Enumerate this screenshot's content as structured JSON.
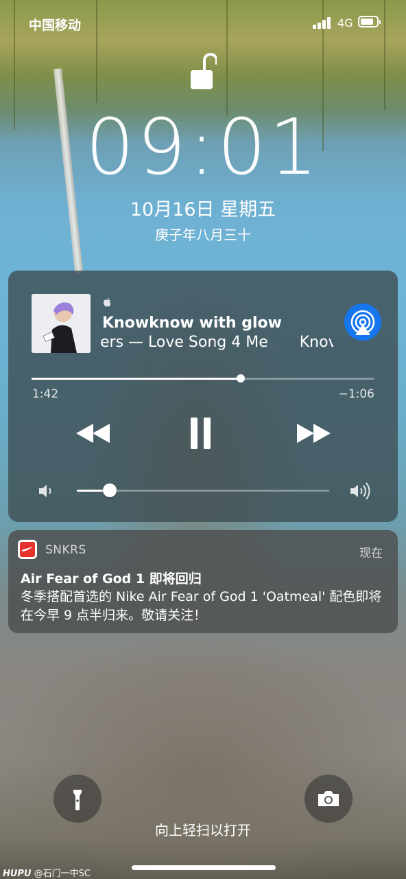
{
  "status_bar": {
    "carrier": "中国移动",
    "network": "4G",
    "signal_bars": 4,
    "battery_level": 0.8
  },
  "lock_screen": {
    "lock_icon": "unlocked-padlock-icon",
    "time": "09:01",
    "date": "10月16日 星期五",
    "lunar_date": "庚子年八月三十"
  },
  "media_player": {
    "source_icon": "apple-logo-icon",
    "track_title": "Knowknow with glow",
    "subtitle": "ers — Love Song 4 Me",
    "subtitle_next": "Knov",
    "elapsed": "1:42",
    "remaining": "−1:06",
    "progress": 0.61,
    "volume": 0.13,
    "controls": [
      "rewind-icon",
      "pause-icon",
      "fast-forward-icon"
    ],
    "airplay_icon": "airplay-icon",
    "accent_color": "#1576ee"
  },
  "notification": {
    "app_name": "SNKRS",
    "time": "现在",
    "title": "Air Fear of God 1 即将回归",
    "body": "冬季搭配首选的 Nike Air Fear of God 1 'Oatmeal' 配色即将在今早 9 点半归来。敬请关注！",
    "icon_color": "#e5322d"
  },
  "bottom": {
    "left_button_icon": "flashlight-icon",
    "right_button_icon": "camera-icon",
    "unlock_hint": "向上轻扫以打开"
  },
  "watermark": {
    "brand": "HUPU",
    "author": "@石门一中SC"
  }
}
